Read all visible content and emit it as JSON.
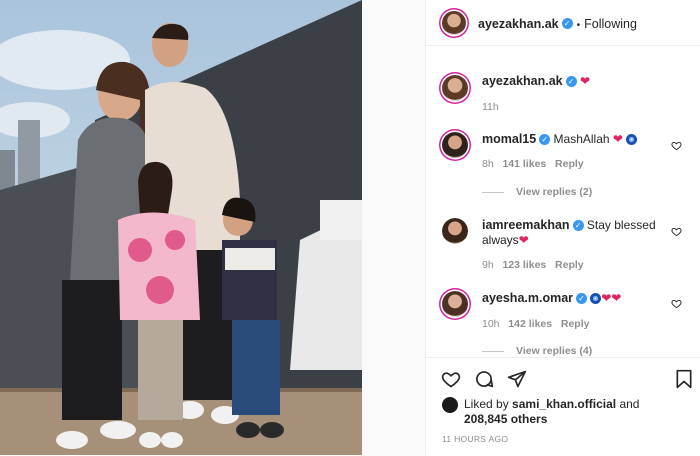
{
  "post": {
    "author": "ayezakhan.ak",
    "follow_status": "Following",
    "caption_author": "ayezakhan.ak",
    "caption_time": "11h",
    "caption_emoji": "❤"
  },
  "comments": [
    {
      "user": "momal15",
      "text": "MashAllah",
      "time": "8h",
      "likes": "141 likes",
      "reply": "Reply",
      "view_replies": "View replies (2)"
    },
    {
      "user": "iamreemakhan",
      "text_line1": "Stay blessed",
      "text_line2": "always",
      "time": "9h",
      "likes": "123 likes",
      "reply": "Reply"
    },
    {
      "user": "ayesha.m.omar",
      "time": "10h",
      "likes": "142 likes",
      "reply": "Reply",
      "view_replies": "View replies (4)"
    }
  ],
  "liked_by": {
    "prefix": "Liked by",
    "user": "sami_khan.official",
    "and": "and",
    "count": "208,845 others"
  },
  "timestamp": "11 HOURS AGO",
  "icons": [
    "heart-icon",
    "comment-icon",
    "share-icon",
    "bookmark-icon",
    "more-icon",
    "verified-icon"
  ],
  "colors": {
    "verified": "#3897f0",
    "heart": "#ed4956",
    "meta": "#8e8e8e"
  }
}
